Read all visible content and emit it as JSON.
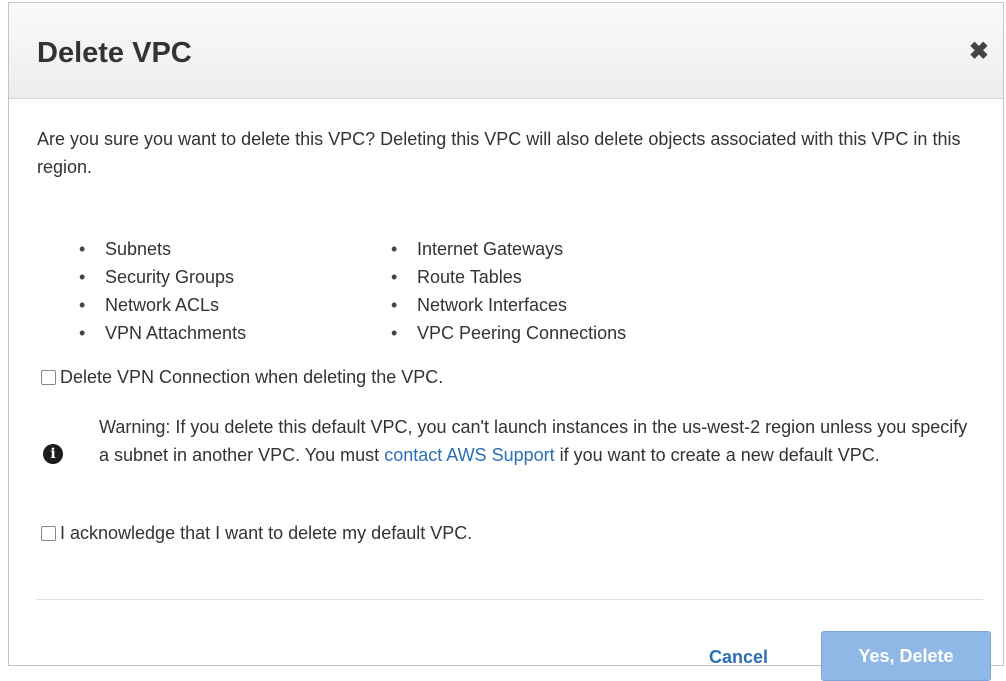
{
  "dialog": {
    "title": "Delete VPC",
    "close_icon": "close-icon",
    "intro": "Are you sure you want to delete this VPC? Deleting this VPC will also delete objects associated with this VPC in this region.",
    "objects_col1": [
      "Subnets",
      "Security Groups",
      "Network ACLs",
      "VPN Attachments"
    ],
    "objects_col2": [
      "Internet Gateways",
      "Route Tables",
      "Network Interfaces",
      "VPC Peering Connections"
    ],
    "vpn_checkbox_label": "Delete VPN Connection when deleting the VPC.",
    "warning_icon": "info-icon",
    "warning": {
      "before_link": "Warning: If you delete this default VPC, you can't launch instances in the us-west-2 region unless you specify a subnet in another VPC. You must ",
      "link_text": "contact AWS Support",
      "after_link": " if you want to create a new default VPC."
    },
    "ack_checkbox_label": "I acknowledge that I want to delete my default VPC.",
    "cancel_label": "Cancel",
    "confirm_label": "Yes, Delete"
  },
  "colors": {
    "link": "#2b6fb6",
    "confirm_disabled": "#8fb8e6"
  }
}
